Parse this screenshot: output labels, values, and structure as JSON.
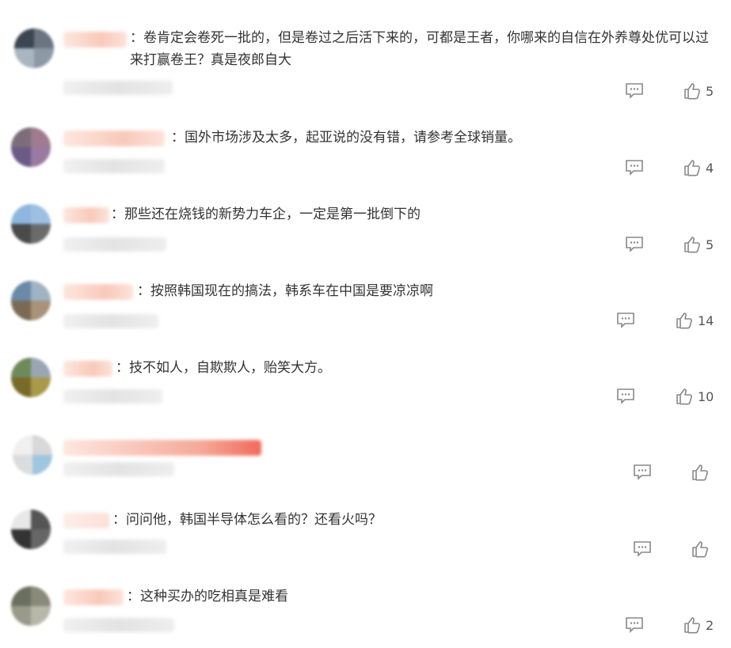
{
  "comments": [
    {
      "text": "：卷肯定会卷死一批的，但是卷过之后活下来的，可都是王者，你哪来的自信在外养尊处优可以过来打赢卷王？真是夜郎自大",
      "likes": "5"
    },
    {
      "text": "：国外市场涉及太多，起亚说的没有错，请参考全球销量。",
      "likes": "4"
    },
    {
      "text": "：那些还在烧钱的新势力车企，一定是第一批倒下的",
      "likes": "5"
    },
    {
      "text": "：按照韩国现在的搞法，韩系车在中国是要凉凉啊",
      "likes": "14"
    },
    {
      "text": "：技不如人，自欺欺人，贻笑大方。",
      "likes": "10"
    },
    {
      "text": "",
      "likes": ""
    },
    {
      "text": "：问问他，韩国半导体怎么看的？还看火吗？",
      "likes": ""
    },
    {
      "text": "：这种买办的吃相真是难看",
      "likes": "2"
    }
  ],
  "icons": {
    "reply": "comment-bubble-icon",
    "like": "thumbs-up-icon"
  },
  "colors": {
    "text": "#333333",
    "icon": "#888888",
    "name_blur": "#f8c9ba"
  }
}
